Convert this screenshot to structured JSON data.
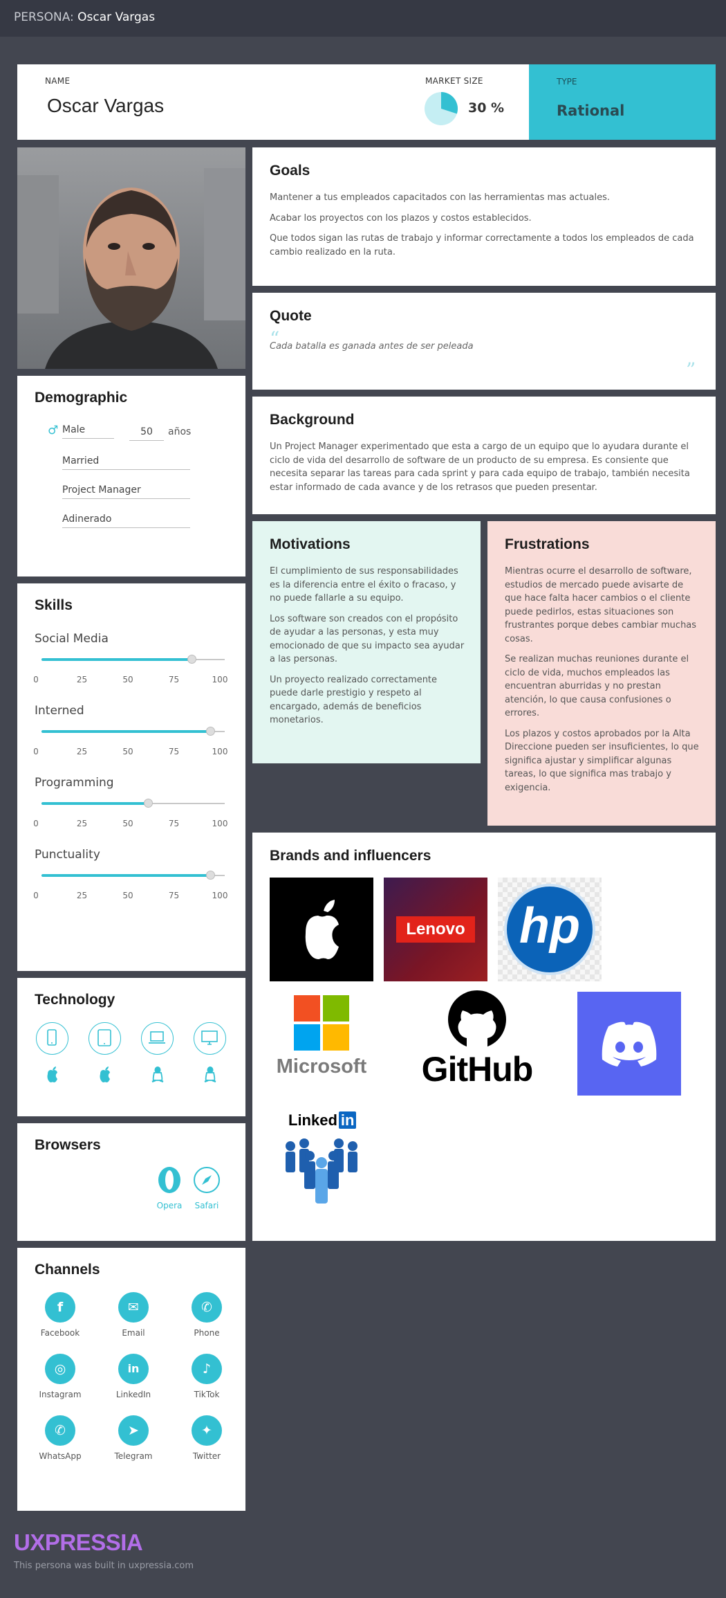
{
  "topbar": {
    "prefix": "PERSONA:",
    "name": "Oscar Vargas"
  },
  "header": {
    "name_label": "NAME",
    "name": "Oscar Vargas",
    "market_label": "MARKET SIZE",
    "market_value": "30 %",
    "market_fraction": 0.3,
    "type_label": "TYPE",
    "type_value": "Rational"
  },
  "goals": {
    "title": "Goals",
    "items": [
      "Mantener a tus empleados capacitados con las herramientas mas actuales.",
      "Acabar los proyectos con los plazos y costos establecidos.",
      "Que todos sigan las rutas de trabajo y informar correctamente a todos los empleados de cada cambio realizado en la ruta."
    ]
  },
  "quote": {
    "title": "Quote",
    "text": "Cada batalla es ganada antes de ser peleada",
    "open_mark": "“",
    "close_mark": "”"
  },
  "background": {
    "title": "Background",
    "text": "Un Project Manager experimentado que esta a cargo de un equipo que lo ayudara durante el ciclo de vida del desarrollo de software de un producto de su empresa. Es consiente que necesita separar las tareas para cada sprint y para cada equipo de trabajo, también necesita estar informado de cada avance y de los retrasos que pueden presentar."
  },
  "demographic": {
    "title": "Demographic",
    "gender_icon": "male-icon",
    "gender": "Male",
    "age": "50",
    "age_unit": "años",
    "marital": "Married",
    "occupation": "Project Manager",
    "income": "Adinerado"
  },
  "skills": {
    "title": "Skills",
    "ticks": [
      "0",
      "25",
      "50",
      "75",
      "100"
    ],
    "items": [
      {
        "label": "Social Media",
        "value": 82
      },
      {
        "label": "Interned",
        "value": 92
      },
      {
        "label": "Programming",
        "value": 58
      },
      {
        "label": "Punctuality",
        "value": 92
      }
    ]
  },
  "technology": {
    "title": "Technology",
    "devices": [
      "smartphone-icon",
      "tablet-icon",
      "laptop-icon",
      "desktop-icon"
    ],
    "os": [
      "apple-icon",
      "apple-icon",
      "linux-icon",
      "linux-icon"
    ]
  },
  "browsers": {
    "title": "Browsers",
    "items": [
      {
        "label": "Opera",
        "icon": "opera-icon"
      },
      {
        "label": "Safari",
        "icon": "safari-icon"
      }
    ]
  },
  "channels": {
    "title": "Channels",
    "items": [
      {
        "label": "Facebook",
        "icon": "facebook-icon",
        "glyph": "f"
      },
      {
        "label": "Email",
        "icon": "email-icon",
        "glyph": "✉"
      },
      {
        "label": "Phone",
        "icon": "phone-icon",
        "glyph": "✆"
      },
      {
        "label": "Instagram",
        "icon": "instagram-icon",
        "glyph": "◎"
      },
      {
        "label": "LinkedIn",
        "icon": "linkedin-icon",
        "glyph": "in"
      },
      {
        "label": "TikTok",
        "icon": "tiktok-icon",
        "glyph": "♪"
      },
      {
        "label": "WhatsApp",
        "icon": "whatsapp-icon",
        "glyph": "✆"
      },
      {
        "label": "Telegram",
        "icon": "telegram-icon",
        "glyph": "➤"
      },
      {
        "label": "Twitter",
        "icon": "twitter-icon",
        "glyph": "✦"
      }
    ]
  },
  "motivations": {
    "title": "Motivations",
    "items": [
      "El cumplimiento de sus responsabilidades es la diferencia entre el éxito o fracaso, y no puede fallarle a su equipo.",
      "Los software son creados con el propósito de ayudar a las personas, y esta muy emocionado de que su impacto sea ayudar a las personas.",
      "Un proyecto realizado correctamente puede darle prestigio y respeto al encargado, además de beneficios monetarios."
    ]
  },
  "frustrations": {
    "title": "Frustrations",
    "items": [
      "Mientras ocurre el desarrollo de software, estudios de mercado puede avisarte de que hace falta hacer cambios o el cliente puede pedirlos, estas situaciones son frustrantes porque debes cambiar muchas cosas.",
      "Se realizan muchas reuniones durante el ciclo de vida, muchos empleados las encuentran aburridas y no prestan atención, lo que causa confusiones o errores.",
      "Los plazos y costos aprobados por la Alta Direccione pueden ser insuficientes, lo que significa ajustar y simplificar algunas tareas, lo que significa mas trabajo y exigencia."
    ]
  },
  "brands": {
    "title": "Brands and influencers",
    "logos": {
      "lenovo": "Lenovo",
      "hp": "hp",
      "microsoft": "Microsoft",
      "github": "GitHub",
      "linkedin_word": "Linked",
      "linkedin_in": "in"
    }
  },
  "footer": {
    "logo": "UXPRESSIA",
    "note": "This persona was built in uxpressia.com"
  },
  "colors": {
    "accent": "#33c0d2",
    "background": "#434650",
    "motivations": "#e3f6f1",
    "frustrations": "#f9dcd8"
  }
}
